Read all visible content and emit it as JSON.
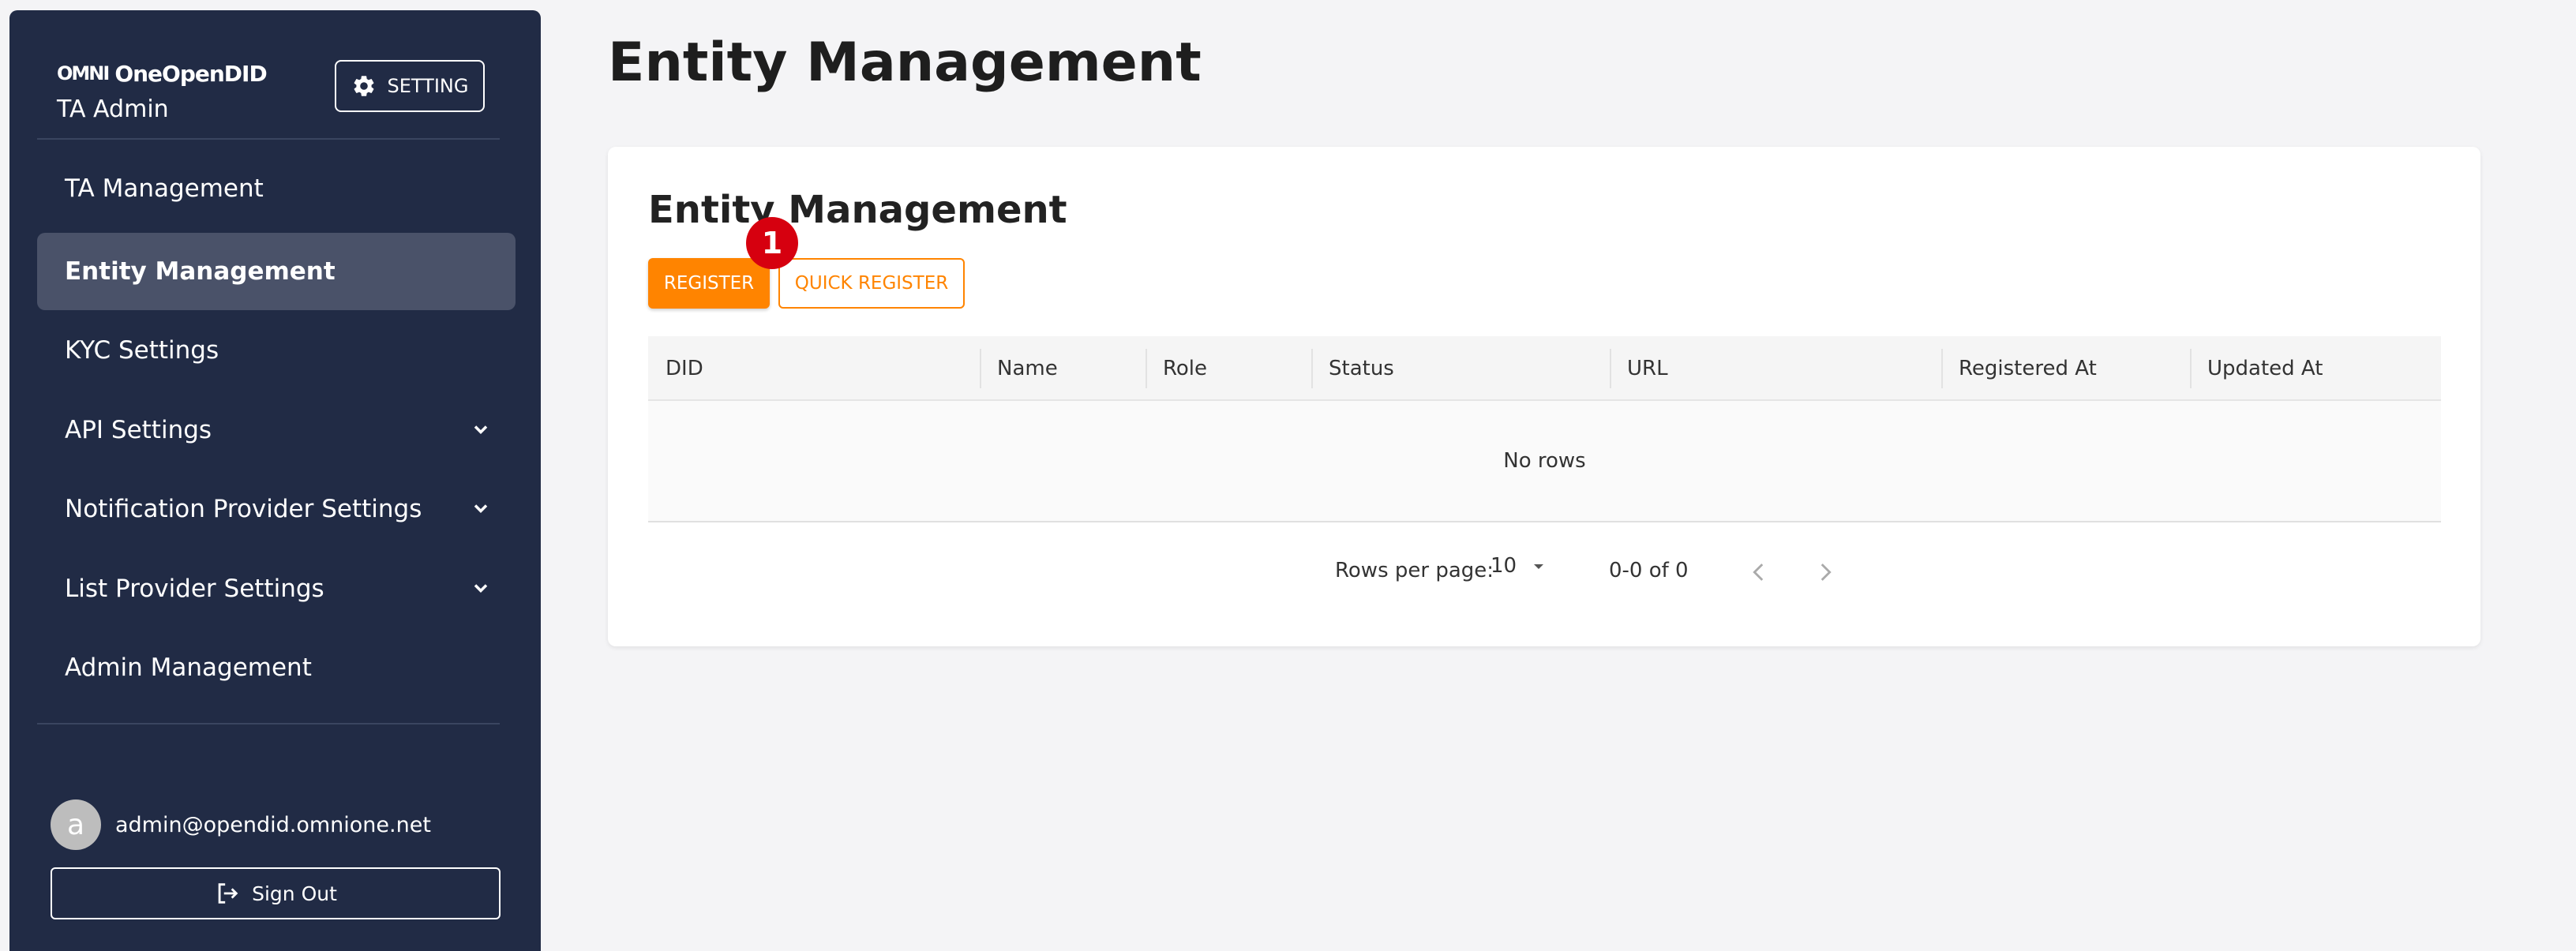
{
  "brand": {
    "logo_mark": "OMNI",
    "logo_text": "OneOpenDID",
    "subtitle": "TA Admin"
  },
  "header": {
    "setting_label": "SETTING"
  },
  "sidebar": {
    "items": [
      {
        "label": "TA Management"
      },
      {
        "label": "Entity Management"
      },
      {
        "label": "KYC Settings"
      },
      {
        "label": "API Settings"
      },
      {
        "label": "Notification Provider Settings"
      },
      {
        "label": "List Provider Settings"
      },
      {
        "label": "Admin Management"
      }
    ],
    "active_index": 1
  },
  "user": {
    "avatar_letter": "a",
    "email": "admin@opendid.omnione.net",
    "signout_label": "Sign Out"
  },
  "main": {
    "page_title": "Entity Management",
    "card_title": "Entity Management",
    "register_label": "REGISTER",
    "quick_register_label": "QUICK REGISTER",
    "step_badge": "1",
    "table": {
      "columns": [
        "DID",
        "Name",
        "Role",
        "Status",
        "URL",
        "Registered At",
        "Updated At"
      ],
      "empty_text": "No rows"
    },
    "pagination": {
      "rows_per_page_label": "Rows per page:",
      "rows_per_page": "10",
      "range": "0-0 of 0"
    }
  },
  "colors": {
    "sidebar_bg": "#212b45",
    "accent": "#ff8400",
    "badge": "#d6000f"
  }
}
